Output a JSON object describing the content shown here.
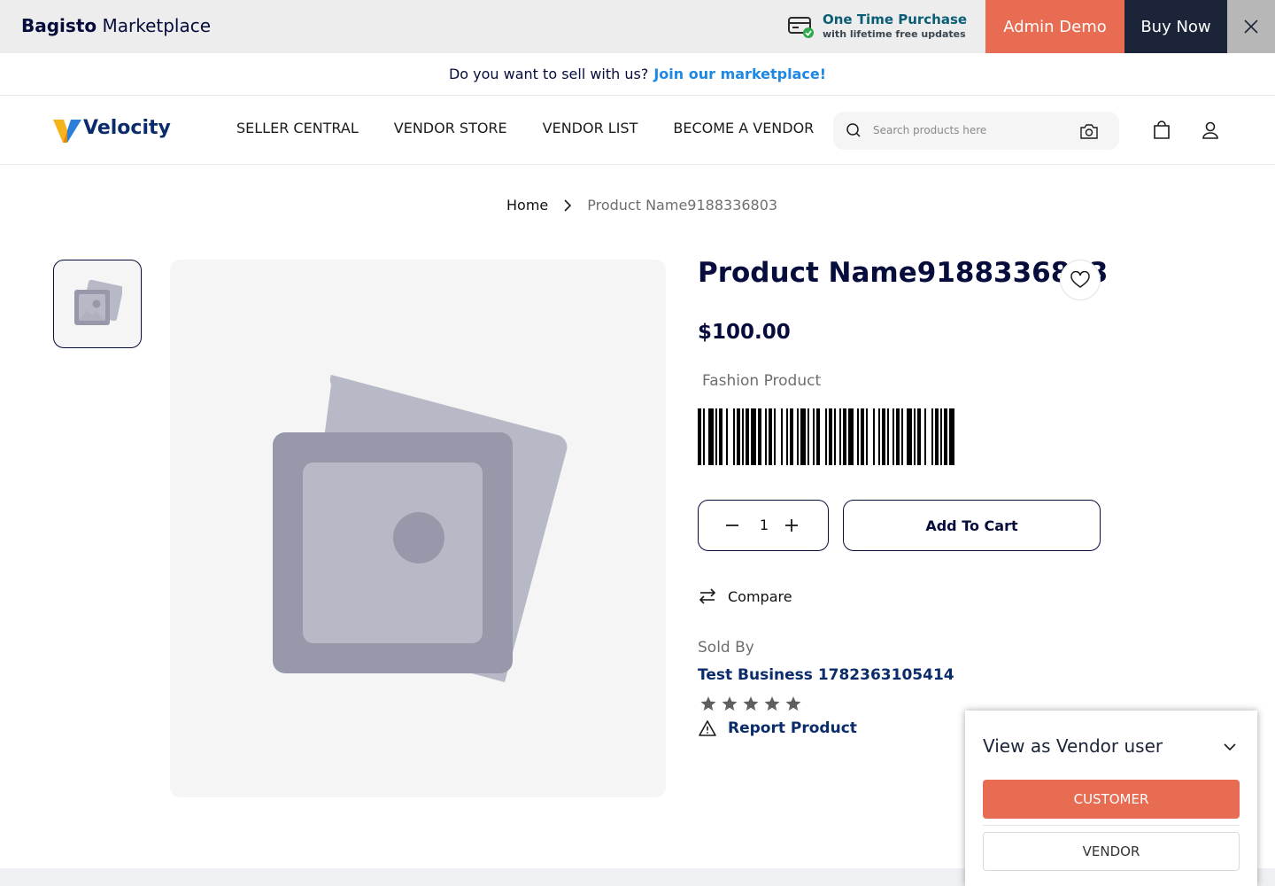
{
  "promo": {
    "brand_bold": "Bagisto",
    "brand_regular": "Marketplace",
    "offer_title": "One Time Purchase",
    "offer_subtitle": "with lifetime free updates",
    "admin_demo_label": "Admin Demo",
    "buy_now_label": "Buy Now"
  },
  "sell_banner": {
    "question": "Do you want to sell with us?",
    "link": "Join our marketplace!"
  },
  "header": {
    "logo_text": "Velocity",
    "nav": [
      {
        "label": "SELLER CENTRAL"
      },
      {
        "label": "VENDOR STORE"
      },
      {
        "label": "VENDOR LIST"
      },
      {
        "label": "BECOME A VENDOR"
      }
    ],
    "search": {
      "placeholder": "Search products here",
      "value": ""
    }
  },
  "breadcrumb": {
    "home": "Home",
    "current": "Product Name9188336803"
  },
  "product": {
    "name": "Product Name9188336803",
    "price": "$100.00",
    "category": "Fashion Product",
    "quantity": "1",
    "add_to_cart_label": "Add To Cart",
    "compare_label": "Compare",
    "sold_by_label": "Sold By",
    "seller_name": "Test Business 1782363105414",
    "rating": 0,
    "rating_max": 5,
    "report_label": "Report Product"
  },
  "view_as": {
    "title": "View as Vendor user",
    "customer_label": "CUSTOMER",
    "vendor_label": "VENDOR"
  },
  "colors": {
    "brand_navy": "#060c3b",
    "accent_orange": "#e86c52",
    "buy_dark": "#1b2438",
    "link_blue": "#1e88e5",
    "offer_teal": "#0b5e76"
  },
  "icons": [
    "card-check-icon",
    "close-icon",
    "velocity-logo-icon",
    "search-icon",
    "camera-icon",
    "bag-icon",
    "user-icon",
    "chevron-right-icon",
    "image-placeholder-icon",
    "heart-icon",
    "minus-icon",
    "plus-icon",
    "compare-arrows-icon",
    "star-icon",
    "warning-icon",
    "chevron-down-icon"
  ]
}
